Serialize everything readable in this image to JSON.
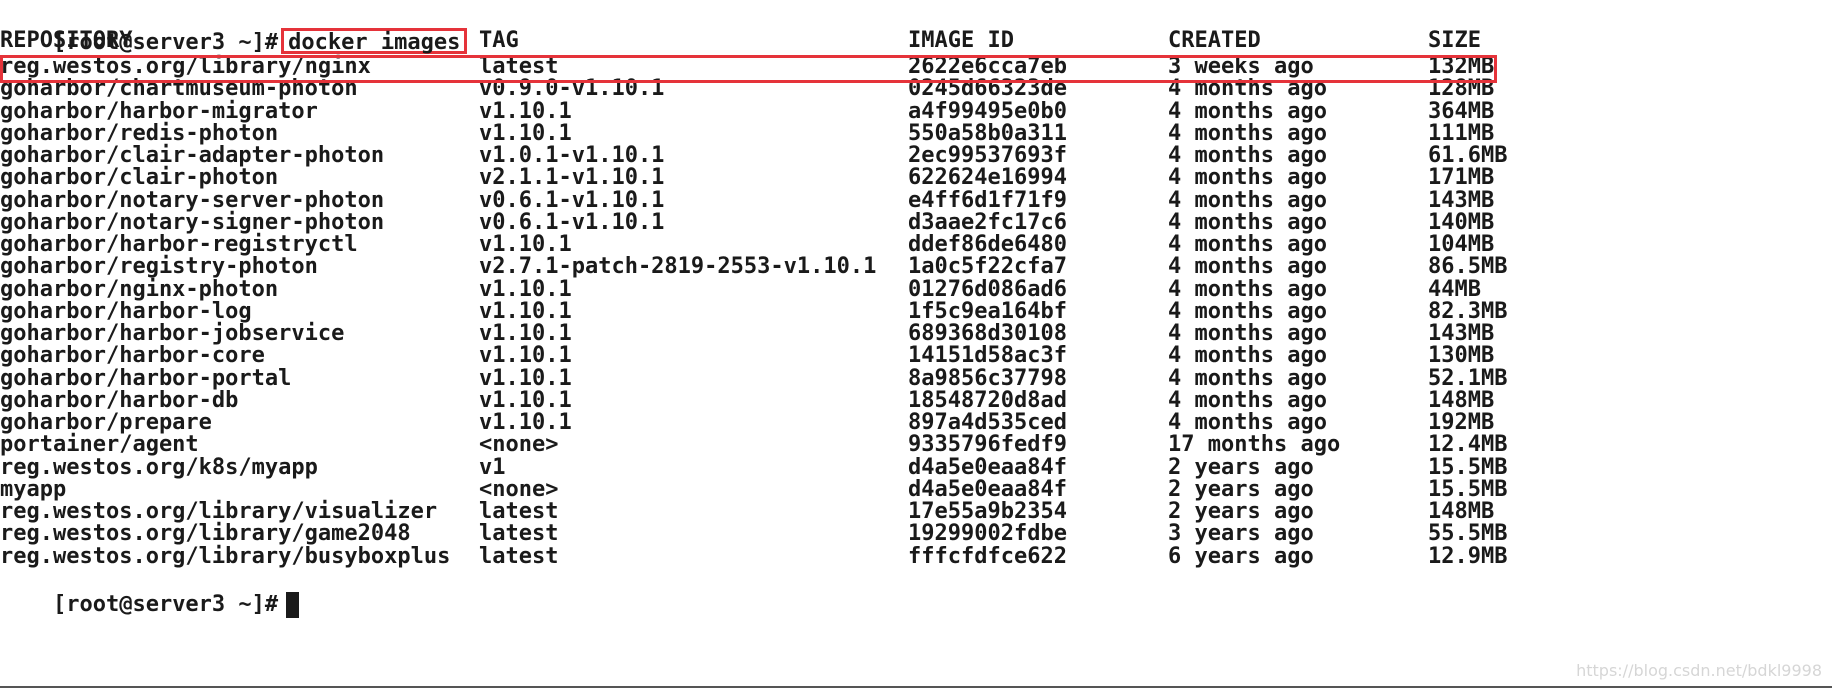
{
  "terminal": {
    "prompt": "[root@server3 ~]#",
    "command": "docker images",
    "final_prompt": "[root@server3 ~]#"
  },
  "table": {
    "headers": [
      "REPOSITORY",
      "TAG",
      "IMAGE ID",
      "CREATED",
      "SIZE"
    ],
    "rows": [
      [
        "reg.westos.org/library/nginx",
        "latest",
        "2622e6cca7eb",
        "3 weeks ago",
        "132MB"
      ],
      [
        "goharbor/chartmuseum-photon",
        "v0.9.0-v1.10.1",
        "0245d66323de",
        "4 months ago",
        "128MB"
      ],
      [
        "goharbor/harbor-migrator",
        "v1.10.1",
        "a4f99495e0b0",
        "4 months ago",
        "364MB"
      ],
      [
        "goharbor/redis-photon",
        "v1.10.1",
        "550a58b0a311",
        "4 months ago",
        "111MB"
      ],
      [
        "goharbor/clair-adapter-photon",
        "v1.0.1-v1.10.1",
        "2ec99537693f",
        "4 months ago",
        "61.6MB"
      ],
      [
        "goharbor/clair-photon",
        "v2.1.1-v1.10.1",
        "622624e16994",
        "4 months ago",
        "171MB"
      ],
      [
        "goharbor/notary-server-photon",
        "v0.6.1-v1.10.1",
        "e4ff6d1f71f9",
        "4 months ago",
        "143MB"
      ],
      [
        "goharbor/notary-signer-photon",
        "v0.6.1-v1.10.1",
        "d3aae2fc17c6",
        "4 months ago",
        "140MB"
      ],
      [
        "goharbor/harbor-registryctl",
        "v1.10.1",
        "ddef86de6480",
        "4 months ago",
        "104MB"
      ],
      [
        "goharbor/registry-photon",
        "v2.7.1-patch-2819-2553-v1.10.1",
        "1a0c5f22cfa7",
        "4 months ago",
        "86.5MB"
      ],
      [
        "goharbor/nginx-photon",
        "v1.10.1",
        "01276d086ad6",
        "4 months ago",
        "44MB"
      ],
      [
        "goharbor/harbor-log",
        "v1.10.1",
        "1f5c9ea164bf",
        "4 months ago",
        "82.3MB"
      ],
      [
        "goharbor/harbor-jobservice",
        "v1.10.1",
        "689368d30108",
        "4 months ago",
        "143MB"
      ],
      [
        "goharbor/harbor-core",
        "v1.10.1",
        "14151d58ac3f",
        "4 months ago",
        "130MB"
      ],
      [
        "goharbor/harbor-portal",
        "v1.10.1",
        "8a9856c37798",
        "4 months ago",
        "52.1MB"
      ],
      [
        "goharbor/harbor-db",
        "v1.10.1",
        "18548720d8ad",
        "4 months ago",
        "148MB"
      ],
      [
        "goharbor/prepare",
        "v1.10.1",
        "897a4d535ced",
        "4 months ago",
        "192MB"
      ],
      [
        "portainer/agent",
        "<none>",
        "9335796fedf9",
        "17 months ago",
        "12.4MB"
      ],
      [
        "reg.westos.org/k8s/myapp",
        "v1",
        "d4a5e0eaa84f",
        "2 years ago",
        "15.5MB"
      ],
      [
        "myapp",
        "<none>",
        "d4a5e0eaa84f",
        "2 years ago",
        "15.5MB"
      ],
      [
        "reg.westos.org/library/visualizer",
        "latest",
        "17e55a9b2354",
        "2 years ago",
        "148MB"
      ],
      [
        "reg.westos.org/library/game2048",
        "latest",
        "19299002fdbe",
        "3 years ago",
        "55.5MB"
      ],
      [
        "reg.westos.org/library/busyboxplus",
        "latest",
        "fffcfdfce622",
        "6 years ago",
        "12.9MB"
      ]
    ]
  },
  "watermark": "https://blog.csdn.net/bdkl9998",
  "colors": {
    "highlight": "#e5333a",
    "text": "#1a1a1a",
    "background": "#ffffff"
  }
}
